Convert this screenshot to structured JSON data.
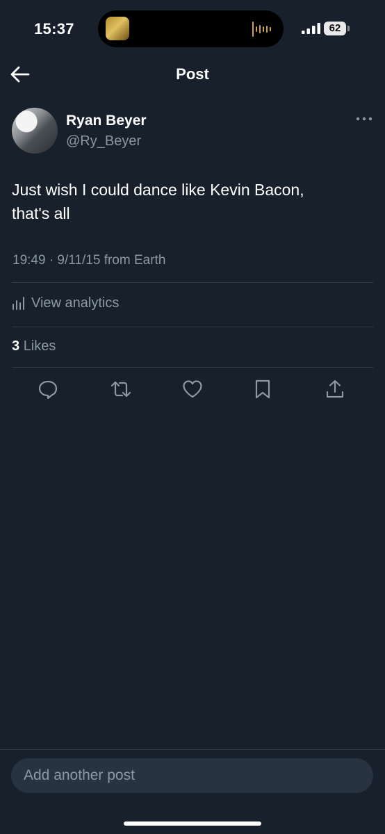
{
  "status": {
    "time": "15:37",
    "battery": "62"
  },
  "header": {
    "title": "Post"
  },
  "post": {
    "author_name": "Ryan Beyer",
    "author_handle": "@Ry_Beyer",
    "text_line1": "Just wish I could dance like Kevin Bacon,",
    "text_line2": "that's all",
    "meta": "19:49 · 9/11/15 from Earth",
    "analytics_label": "View analytics",
    "likes_count": "3",
    "likes_label": "Likes"
  },
  "composer": {
    "placeholder": "Add another post"
  },
  "icons": {
    "back": "arrow-left-icon",
    "more": "more-icon",
    "analytics": "bar-chart-icon",
    "reply": "reply-icon",
    "repost": "repost-icon",
    "like": "heart-icon",
    "bookmark": "bookmark-icon",
    "share": "share-icon"
  },
  "colors": {
    "background": "#17202b",
    "secondary_text": "#8b98a5",
    "divider": "#2f3b47",
    "composer_bg": "#273340"
  }
}
